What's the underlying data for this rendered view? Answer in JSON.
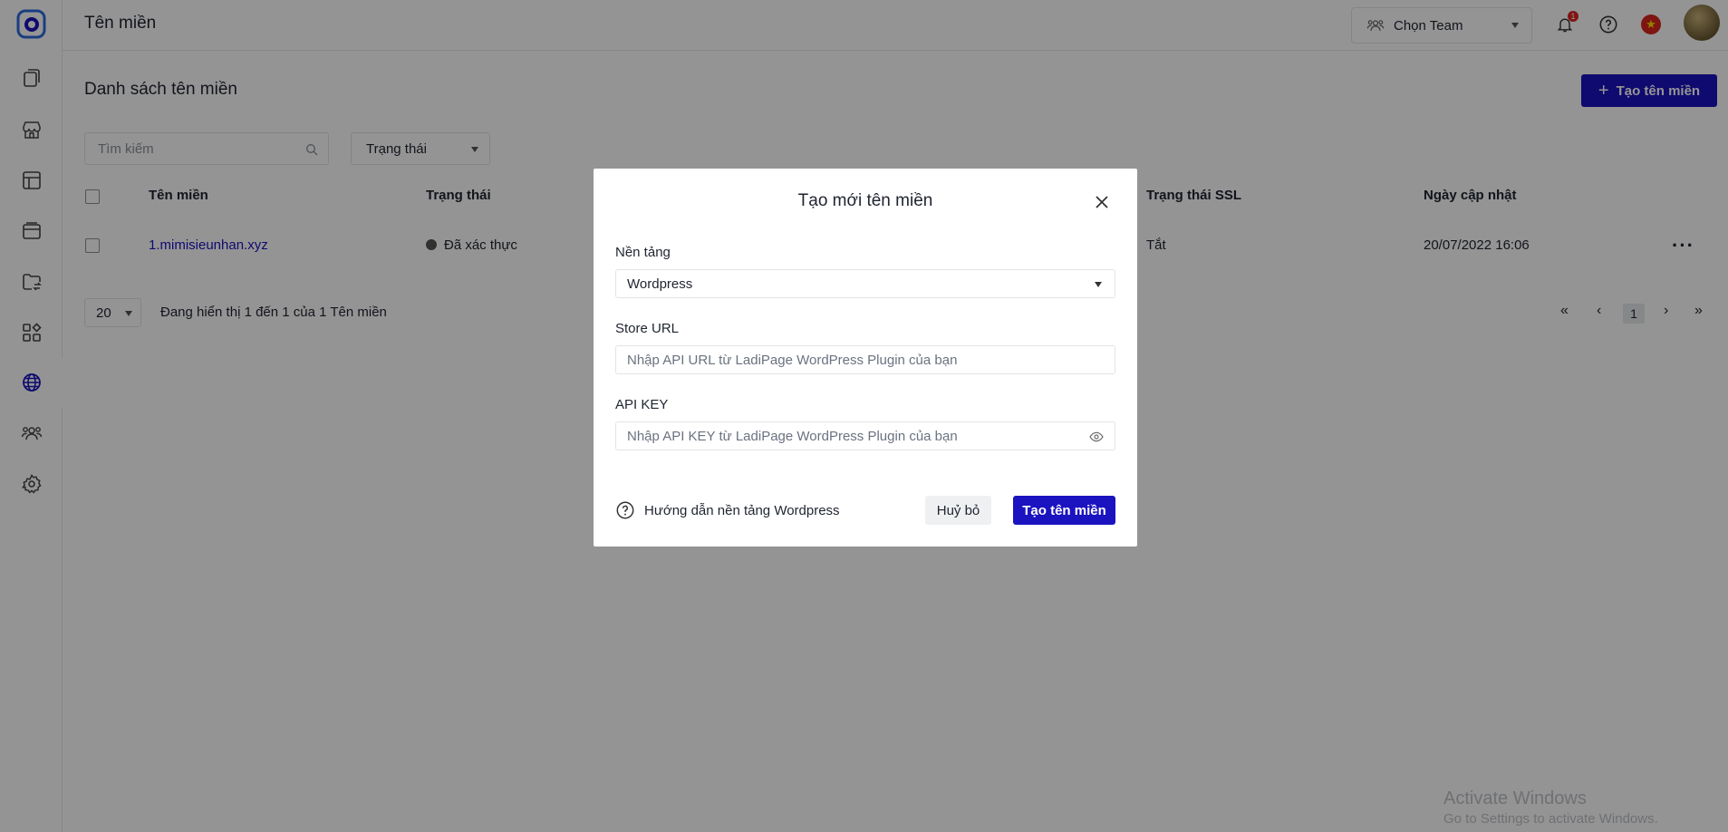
{
  "header": {
    "title": "Tên miền",
    "team_select": "Chọn Team",
    "notification_count": "1",
    "language_flag": "vietnam-flag-icon"
  },
  "sidebar": {
    "items": [
      {
        "name": "pages-icon"
      },
      {
        "name": "store-icon"
      },
      {
        "name": "template-icon"
      },
      {
        "name": "browser-icon"
      },
      {
        "name": "folder-transfer-icon"
      },
      {
        "name": "apps-icon"
      },
      {
        "name": "globe-icon",
        "active": true
      },
      {
        "name": "team-icon"
      },
      {
        "name": "settings-icon"
      }
    ]
  },
  "main": {
    "heading": "Danh sách tên miền",
    "create_button": "Tạo tên miền",
    "search_placeholder": "Tìm kiếm",
    "status_filter": "Trạng thái",
    "table": {
      "columns": [
        "Tên miền",
        "Trạng thái",
        "Trạng thái SSL",
        "Ngày cập nhật"
      ],
      "rows": [
        {
          "domain": "1.mimisieunhan.xyz",
          "status": "Đã xác thực",
          "ssl": "Tắt",
          "updated": "20/07/2022 16:06"
        }
      ]
    },
    "per_page": "20",
    "showing_text": "Đang hiển thị 1 đến 1 của 1 Tên miền",
    "current_page": "1"
  },
  "modal": {
    "title": "Tạo mới tên miền",
    "platform_label": "Nền tảng",
    "platform_value": "Wordpress",
    "store_url_label": "Store URL",
    "store_url_placeholder": "Nhập API URL từ LadiPage WordPress Plugin của bạn",
    "api_key_label": "API KEY",
    "api_key_placeholder": "Nhập API KEY từ LadiPage WordPress Plugin của bạn",
    "help_text": "Hướng dẫn nền tảng Wordpress",
    "cancel_button": "Huỷ bỏ",
    "submit_button": "Tạo tên miền"
  },
  "watermark": {
    "line1": "Activate Windows",
    "line2": "Go to Settings to activate Windows."
  },
  "colors": {
    "primary": "#1b12c0",
    "overlay": "rgba(0,0,0,0.42)"
  }
}
